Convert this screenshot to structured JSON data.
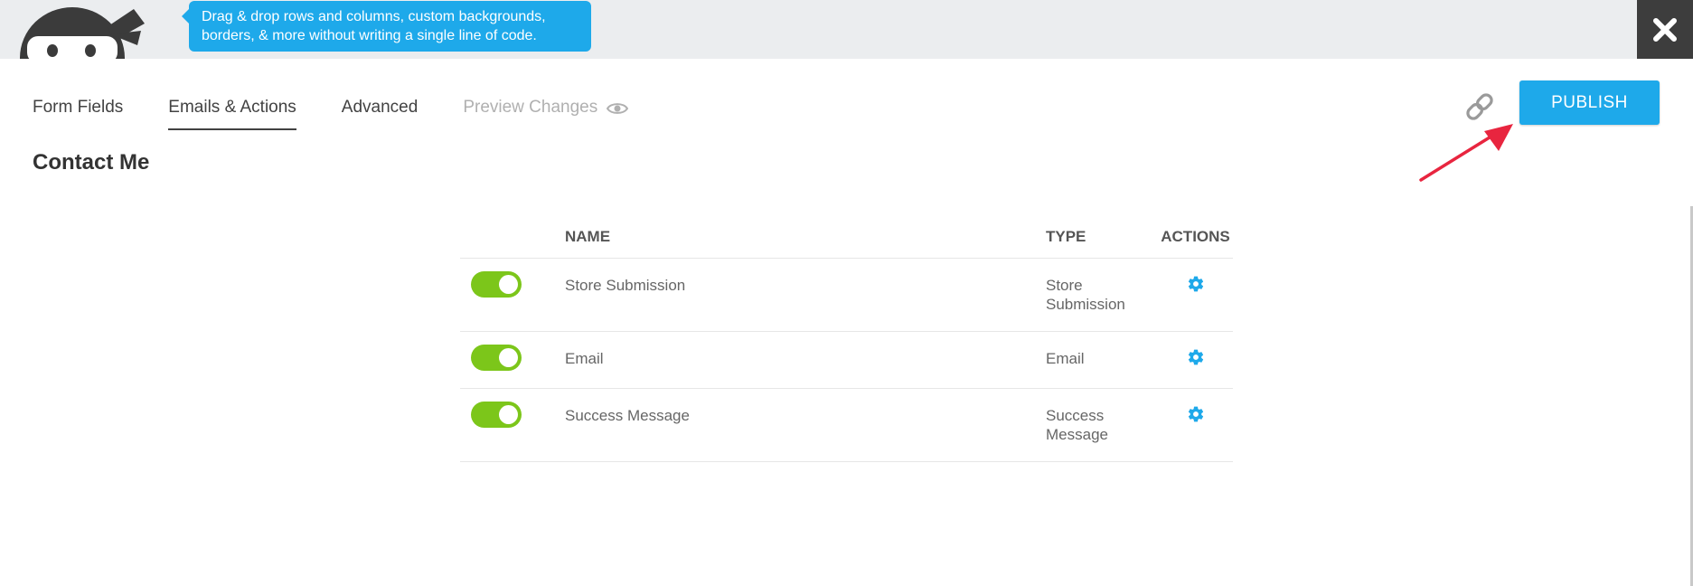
{
  "banner": {
    "tip_line1": "Drag & drop rows and columns, custom backgrounds,",
    "tip_line2": "borders, & more without writing a single line of code.",
    "mascot_icon": "ninja-mascot-icon",
    "close_icon": "close-icon"
  },
  "tabs": [
    {
      "label": "Form Fields",
      "active": false
    },
    {
      "label": "Emails & Actions",
      "active": true
    },
    {
      "label": "Advanced",
      "active": false
    },
    {
      "label": "Preview Changes",
      "active": false,
      "disabled": true,
      "icon": "eye-icon"
    }
  ],
  "toolbar": {
    "link_icon": "link-icon",
    "publish_label": "PUBLISH"
  },
  "form": {
    "title": "Contact Me"
  },
  "table": {
    "headers": {
      "name": "NAME",
      "type": "TYPE",
      "actions": "ACTIONS"
    },
    "rows": [
      {
        "enabled": true,
        "name": "Store Submission",
        "type_line1": "Store",
        "type_line2": "Submission"
      },
      {
        "enabled": true,
        "name": "Email",
        "type_line1": "Email",
        "type_line2": ""
      },
      {
        "enabled": true,
        "name": "Success Message",
        "type_line1": "Success",
        "type_line2": "Message"
      }
    ]
  },
  "colors": {
    "accent": "#1ea9ea",
    "toggle_on": "#7cc61a",
    "annotation_arrow": "#e8253f",
    "topbar": "#ebedef",
    "close_bg": "#3d3d3d"
  }
}
